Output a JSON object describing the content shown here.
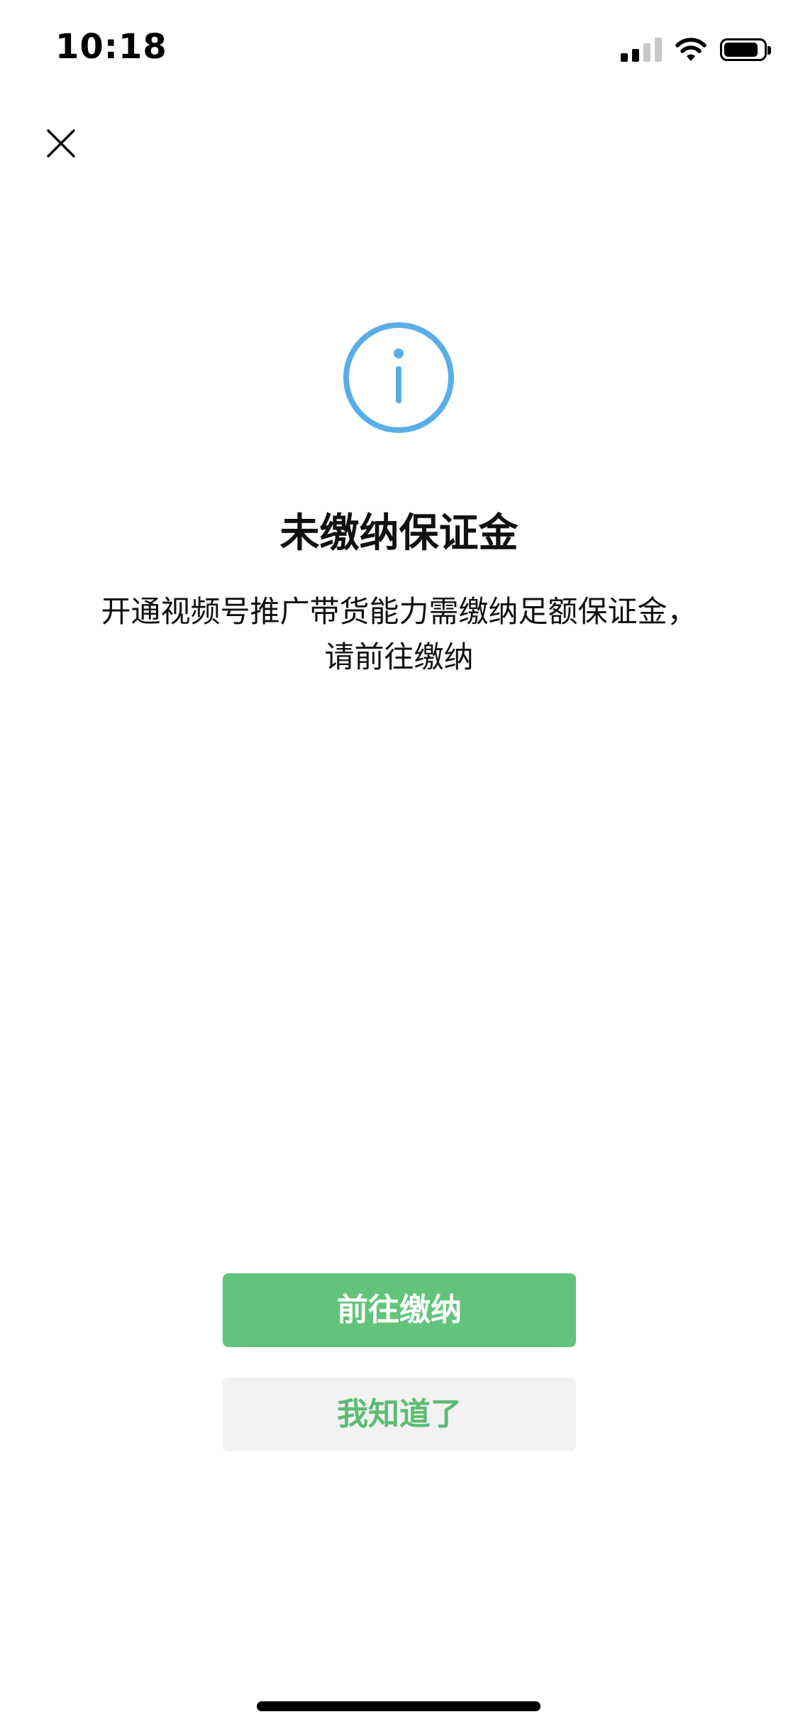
{
  "status_bar": {
    "time": "10:18",
    "icons": [
      "signal-icon",
      "wifi-icon",
      "battery-icon"
    ]
  },
  "header": {
    "close_icon": "close-icon"
  },
  "dialog": {
    "icon": "info-icon",
    "icon_color": "#5aaee8",
    "title": "未缴纳保证金",
    "description_line1": "开通视频号推广带货能力需缴纳足额保证金，",
    "description_line2": "请前往缴纳"
  },
  "actions": {
    "primary_label": "前往缴纳",
    "secondary_label": "我知道了",
    "primary_color": "#62c47a",
    "secondary_bg": "#f2f2f2",
    "secondary_text_color": "#5cbc73"
  }
}
